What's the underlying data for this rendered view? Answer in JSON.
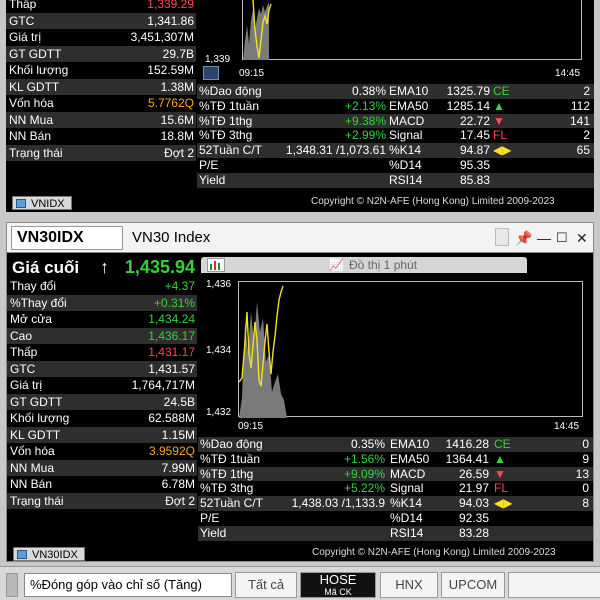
{
  "top": {
    "rows": [
      {
        "label": "Thấp",
        "value": "1,339.29",
        "color": "red"
      },
      {
        "label": "GTC",
        "value": "1,341.86",
        "color": ""
      },
      {
        "label": "Giá trị",
        "value": "3,451,307M",
        "color": ""
      },
      {
        "label": "GT GDTT",
        "value": "29.7B",
        "color": ""
      },
      {
        "label": "Khối lượng",
        "value": "152.59M",
        "color": ""
      },
      {
        "label": "KL GDTT",
        "value": "1.38M",
        "color": ""
      },
      {
        "label": "Vốn hóa",
        "value": "5.7762Q",
        "color": "orange"
      },
      {
        "label": "NN Mua",
        "value": "15.6M",
        "color": ""
      },
      {
        "label": "NN Bán",
        "value": "18.8M",
        "color": ""
      },
      {
        "label": "Trạng thái",
        "value": "Đợt 2",
        "color": ""
      }
    ],
    "chart": {
      "y_min_label": "1,339",
      "x_start": "09:15",
      "x_end": "14:45"
    },
    "stats": [
      {
        "l1": "%Dao động",
        "v1": "0.38%",
        "c1": "",
        "l2": "EMA10",
        "v2": "1325.79",
        "sig": "CE",
        "sigc": "green",
        "n": "2"
      },
      {
        "l1": "%TĐ 1tuần",
        "v1": "+2.13%",
        "c1": "green",
        "l2": "EMA50",
        "v2": "1285.14",
        "sig": "▲",
        "sigc": "green",
        "n": "112"
      },
      {
        "l1": "%TĐ 1thg",
        "v1": "+9.38%",
        "c1": "green",
        "l2": "MACD",
        "v2": "22.72",
        "sig": "▼",
        "sigc": "red",
        "n": "141"
      },
      {
        "l1": "%TĐ 3thg",
        "v1": "+2.99%",
        "c1": "green",
        "l2": "Signal",
        "v2": "17.45",
        "sig": "FL",
        "sigc": "red",
        "n": "2"
      },
      {
        "l1": "52Tuần C/T",
        "v1": "1,348.31 /1,073.61",
        "c1": "",
        "l2": "%K14",
        "v2": "94.87",
        "sig": "◀▶",
        "sigc": "yellow",
        "n": "65"
      },
      {
        "l1": "P/E",
        "v1": "",
        "c1": "",
        "l2": "%D14",
        "v2": "95.35",
        "sig": "",
        "sigc": "",
        "n": ""
      },
      {
        "l1": "Yield",
        "v1": "",
        "c1": "",
        "l2": "RSI14",
        "v2": "85.83",
        "sig": "",
        "sigc": "",
        "n": ""
      }
    ],
    "copyright": "Copyright © N2N-AFE (Hong Kong) Limited 2009-2023",
    "tab": "VNIDX"
  },
  "bottom": {
    "symbol": "VN30IDX",
    "index_name": "VN30 Index",
    "last_label": "Giá cuối",
    "last_arrow": "↑",
    "last_value": "1,435.94",
    "chart_title": "Đồ thị 1 phút",
    "rows": [
      {
        "label": "Thay đổi",
        "value": "+4.37",
        "color": "green"
      },
      {
        "label": "%Thay đổi",
        "value": "+0.31%",
        "color": "green"
      },
      {
        "label": "Mở cửa",
        "value": "1,434.24",
        "color": "green"
      },
      {
        "label": "Cao",
        "value": "1,436.17",
        "color": "green"
      },
      {
        "label": "Thấp",
        "value": "1,431.17",
        "color": "red"
      },
      {
        "label": "GTC",
        "value": "1,431.57",
        "color": ""
      },
      {
        "label": "Giá trị",
        "value": "1,764,717M",
        "color": ""
      },
      {
        "label": "GT GDTT",
        "value": "24.5B",
        "color": ""
      },
      {
        "label": "Khối lượng",
        "value": "62.588M",
        "color": ""
      },
      {
        "label": "KL GDTT",
        "value": "1.15M",
        "color": ""
      },
      {
        "label": "Vốn hóa",
        "value": "3.9592Q",
        "color": "orange"
      },
      {
        "label": "NN Mua",
        "value": "7.99M",
        "color": ""
      },
      {
        "label": "NN Bán",
        "value": "6.78M",
        "color": ""
      },
      {
        "label": "Trạng thái",
        "value": "Đợt 2",
        "color": ""
      }
    ],
    "chart": {
      "y_top": "1,436",
      "y_mid": "1,434",
      "y_bot": "1,432",
      "x_start": "09:15",
      "x_end": "14:45"
    },
    "stats": [
      {
        "l1": "%Dao động",
        "v1": "0.35%",
        "c1": "",
        "l2": "EMA10",
        "v2": "1416.28",
        "sig": "CE",
        "sigc": "green",
        "n": "0"
      },
      {
        "l1": "%TĐ 1tuần",
        "v1": "+1.56%",
        "c1": "green",
        "l2": "EMA50",
        "v2": "1364.41",
        "sig": "▲",
        "sigc": "green",
        "n": "9"
      },
      {
        "l1": "%TĐ 1thg",
        "v1": "+9.09%",
        "c1": "green",
        "l2": "MACD",
        "v2": "26.59",
        "sig": "▼",
        "sigc": "red",
        "n": "13"
      },
      {
        "l1": "%TĐ 3thg",
        "v1": "+5.22%",
        "c1": "green",
        "l2": "Signal",
        "v2": "21.97",
        "sig": "FL",
        "sigc": "red",
        "n": "0"
      },
      {
        "l1": "52Tuần C/T",
        "v1": "1,438.03 /1,133.9",
        "c1": "",
        "l2": "%K14",
        "v2": "94.03",
        "sig": "◀▶",
        "sigc": "yellow",
        "n": "8"
      },
      {
        "l1": "P/E",
        "v1": "",
        "c1": "",
        "l2": "%D14",
        "v2": "92.35",
        "sig": "",
        "sigc": "",
        "n": ""
      },
      {
        "l1": "Yield",
        "v1": "",
        "c1": "",
        "l2": "RSI14",
        "v2": "83.28",
        "sig": "",
        "sigc": "",
        "n": ""
      }
    ],
    "copyright": "Copyright © N2N-AFE (Hong Kong) Limited 2009-2023",
    "tab": "VN30IDX"
  },
  "toolbar": {
    "combo": "%Đóng góp vào chỉ số (Tăng)",
    "all": "Tất cả",
    "hose": "HOSE",
    "hose_sub": "Mã CK",
    "hnx": "HNX",
    "upcom": "UPCOM"
  }
}
